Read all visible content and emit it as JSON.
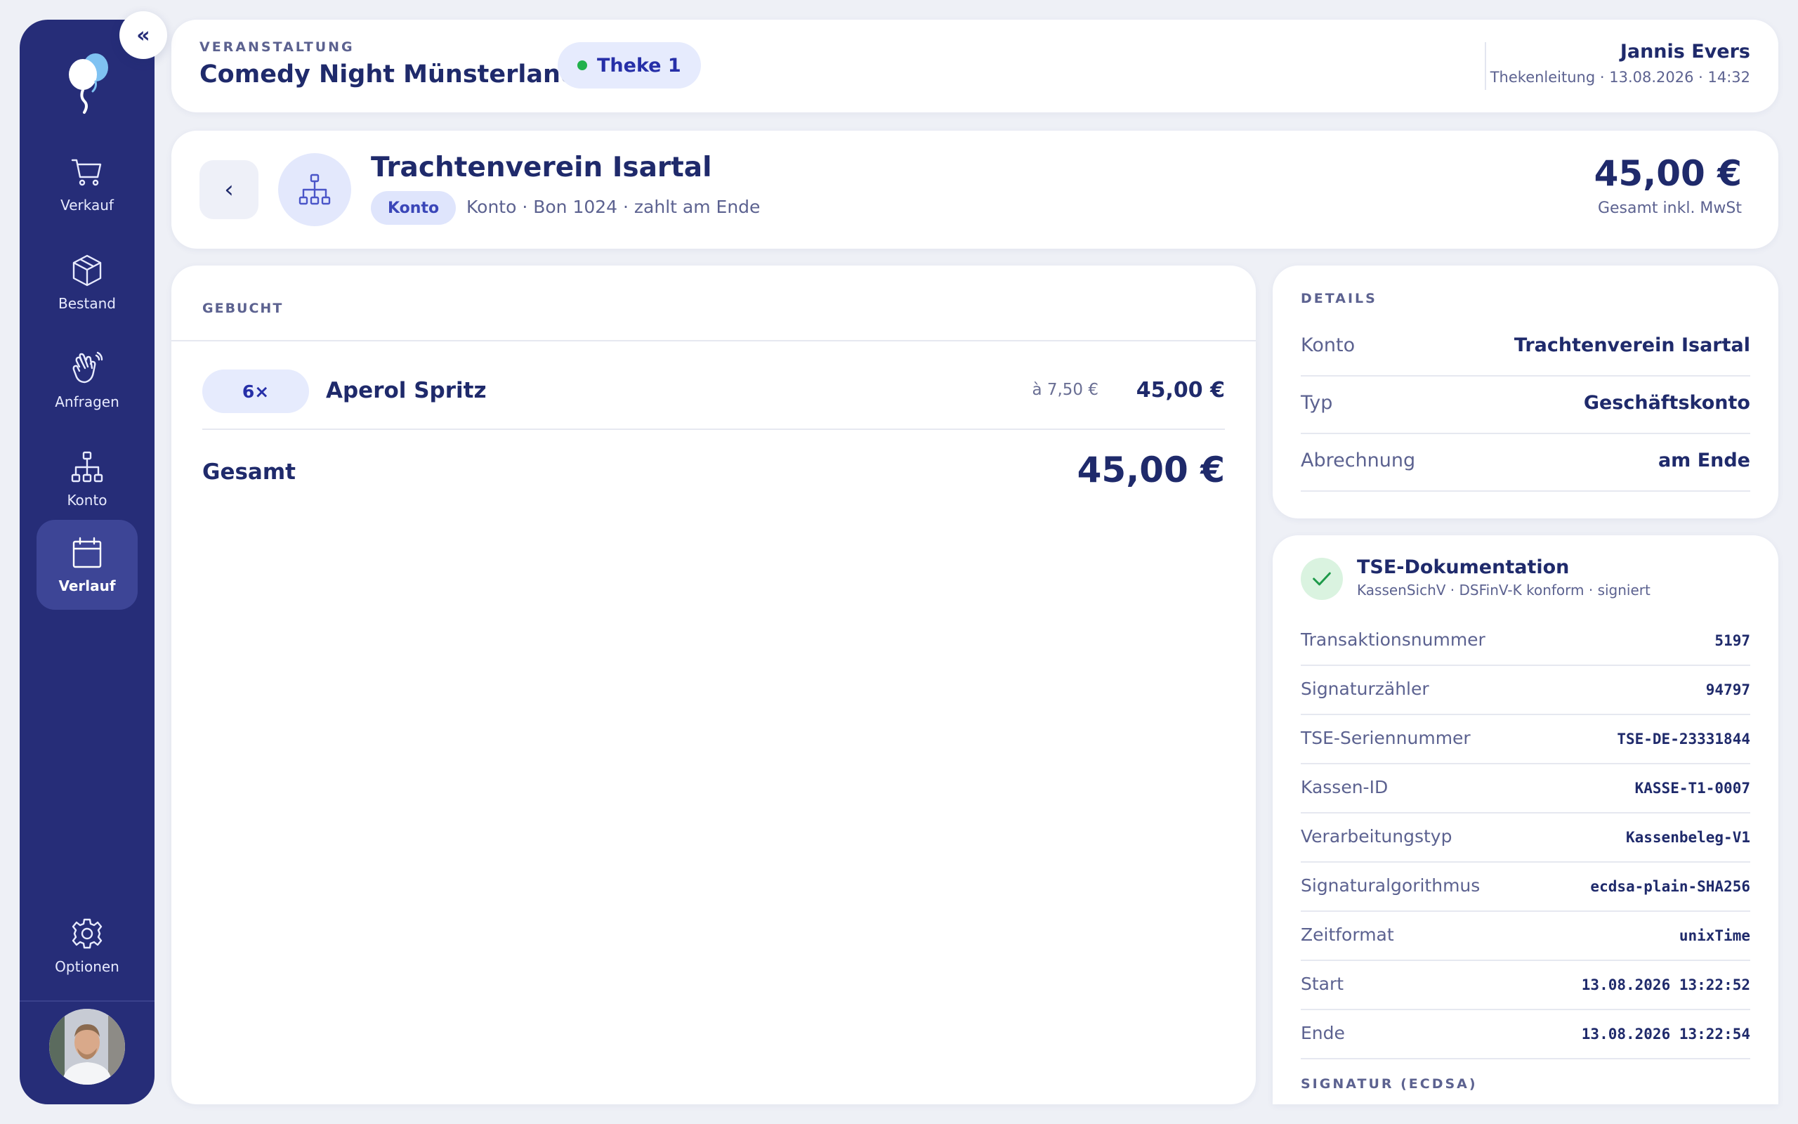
{
  "sidebar": {
    "collapse_glyph": "«",
    "items": [
      {
        "label": "Verkauf",
        "icon": "cart-icon"
      },
      {
        "label": "Bestand",
        "icon": "box-icon"
      },
      {
        "label": "Anfragen",
        "icon": "hand-wave-icon"
      },
      {
        "label": "Konto",
        "icon": "network-icon"
      },
      {
        "label": "Verlauf",
        "icon": "calendar-icon",
        "active": true
      }
    ],
    "options_label": "Optionen"
  },
  "header": {
    "event_caption": "VERANSTALTUNG",
    "event_title": "Comedy Night Münsterland",
    "counter": "Theke 1",
    "user_name": "Jannis Evers",
    "user_meta": "Thekenleitung · 13.08.2026 · 14:32"
  },
  "customer": {
    "back_glyph": "‹",
    "name": "Trachtenverein Isartal",
    "badge": "Konto",
    "meta": "Konto · Bon 1024 · zahlt am Ende",
    "total": "45,00 €",
    "total_label": "Gesamt inkl. MwSt"
  },
  "booked": {
    "caption": "GEBUCHT",
    "items": [
      {
        "qty": "6×",
        "name": "Aperol Spritz",
        "unit": "à 7,50 €",
        "total": "45,00 €"
      }
    ],
    "sum_label": "Gesamt",
    "sum_value": "45,00 €"
  },
  "details": {
    "caption": "DETAILS",
    "rows": [
      {
        "key": "Konto",
        "value": "Trachtenverein Isartal"
      },
      {
        "key": "Typ",
        "value": "Geschäftskonto"
      },
      {
        "key": "Abrechnung",
        "value": "am Ende"
      }
    ]
  },
  "tse": {
    "title": "TSE-Dokumentation",
    "subtitle": "KassenSichV · DSFinV-K konform · signiert",
    "rows": [
      {
        "key": "Transaktionsnummer",
        "value": "5197"
      },
      {
        "key": "Signaturzähler",
        "value": "94797"
      },
      {
        "key": "TSE-Seriennummer",
        "value": "TSE-DE-23331844"
      },
      {
        "key": "Kassen-ID",
        "value": "KASSE-T1-0007"
      },
      {
        "key": "Verarbeitungstyp",
        "value": "Kassenbeleg-V1"
      },
      {
        "key": "Signaturalgorithmus",
        "value": "ecdsa-plain-SHA256"
      },
      {
        "key": "Zeitformat",
        "value": "unixTime"
      },
      {
        "key": "Start",
        "value": "13.08.2026 13:22:52"
      },
      {
        "key": "Ende",
        "value": "13.08.2026 13:22:54"
      }
    ],
    "signature_caption": "SIGNATUR (ECDSA)"
  },
  "colors": {
    "sidebar": "#262d78",
    "accent": "#262fa8",
    "status_online": "#22b14c",
    "text_primary": "#1f2a6b",
    "text_muted": "#5c6290"
  }
}
